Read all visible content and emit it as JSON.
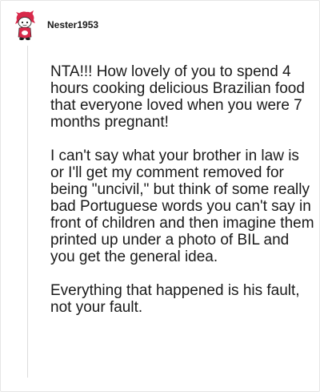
{
  "comment": {
    "username": "Nester1953",
    "avatar_icon": "snoo-avatar-icon",
    "paragraphs": [
      "NTA!!! How lovely of you to spend 4 hours cooking delicious Brazilian food that everyone loved when you were 7 months pregnant!",
      "I can't say what your brother in law is or I'll get my comment removed for being \"uncivil,\" but think of some really bad Portuguese words you can't say in front of children and then imagine them printed up under a photo of BIL and you get the general idea.",
      "Everything that happened is his fault, not your fault."
    ]
  },
  "colors": {
    "text": "#1a1a1a",
    "avatar_red": "#d8294a",
    "thread_line": "#dcdcdc"
  }
}
